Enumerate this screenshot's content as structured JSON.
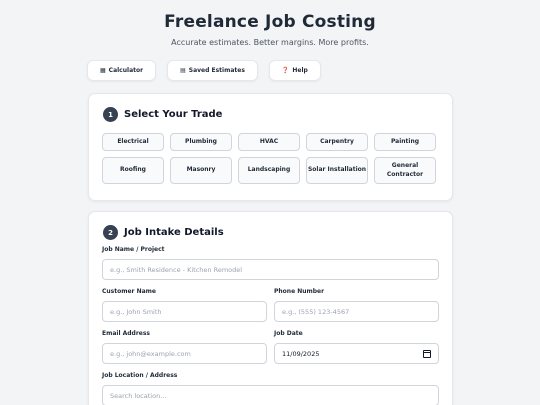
{
  "header": {
    "title": "Freelance Job Costing",
    "subtitle": "Accurate estimates. Better margins. More profits."
  },
  "nav": [
    {
      "icon": "calculator-icon",
      "glyph": "▦",
      "label": "Calculator"
    },
    {
      "icon": "clipboard-icon",
      "glyph": "▤",
      "label": "Saved Estimates"
    },
    {
      "icon": "question-icon",
      "glyph": "❓",
      "label": "Help"
    }
  ],
  "trade_section": {
    "step": "1",
    "title": "Select Your Trade",
    "trades": [
      "Electrical",
      "Plumbing",
      "HVAC",
      "Carpentry",
      "Painting",
      "Roofing",
      "Masonry",
      "Landscaping",
      "Solar Installation",
      "General Contractor"
    ]
  },
  "intake_section": {
    "step": "2",
    "title": "Job Intake Details",
    "job_name": {
      "label": "Job Name / Project",
      "placeholder": "e.g., Smith Residence - Kitchen Remodel"
    },
    "customer_name": {
      "label": "Customer Name",
      "placeholder": "e.g., John Smith"
    },
    "phone": {
      "label": "Phone Number",
      "placeholder": "e.g., (555) 123-4567"
    },
    "email": {
      "label": "Email Address",
      "placeholder": "e.g., john@example.com"
    },
    "job_date": {
      "label": "Job Date",
      "value": "11/09/2025"
    },
    "location": {
      "label": "Job Location / Address",
      "placeholder": "Search location..."
    }
  }
}
